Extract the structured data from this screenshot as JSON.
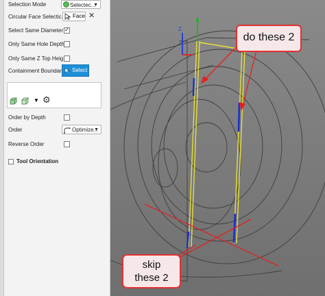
{
  "panel": {
    "selection_mode": {
      "label": "Selection Mode",
      "value": "Selectec...",
      "icon": "green-circle-icon"
    },
    "circular_face_selection": {
      "label": "Circular Face Selectic...",
      "button_label": "Face",
      "clear_icon": "close-icon"
    },
    "select_same_diameter": {
      "label": "Select Same Diameter",
      "checked": true
    },
    "only_same_hole_depth": {
      "label": "Only Same Hole Depth",
      "checked": false
    },
    "only_same_z_top_height": {
      "label": "Only Same Z Top Heig...",
      "checked": false
    },
    "containment_boundary": {
      "label": "Containment Boundary",
      "button_label": "Select"
    },
    "boundary_tools": [
      "boundary-face-icon",
      "boundary-sketch-icon",
      "dropdown-caret-icon",
      "settings-gear-icon"
    ],
    "order_by_depth": {
      "label": "Order by Depth",
      "checked": false
    },
    "order": {
      "label": "Order",
      "value": "Optimize..."
    },
    "reverse_order": {
      "label": "Reverse Order",
      "checked": false
    },
    "tool_orientation": {
      "label": "Tool Orientation",
      "checked": false
    }
  },
  "viewport": {
    "axis_z_label": "Z",
    "annotations": {
      "do_these": "do these 2",
      "skip_these_line1": "skip",
      "skip_these_line2": "these 2"
    },
    "colors": {
      "annotation_red": "#e52020",
      "toolpath_yellow": "#e7e03a",
      "hole_blue": "#1a2fd0",
      "background": "#7d7d7d"
    }
  }
}
